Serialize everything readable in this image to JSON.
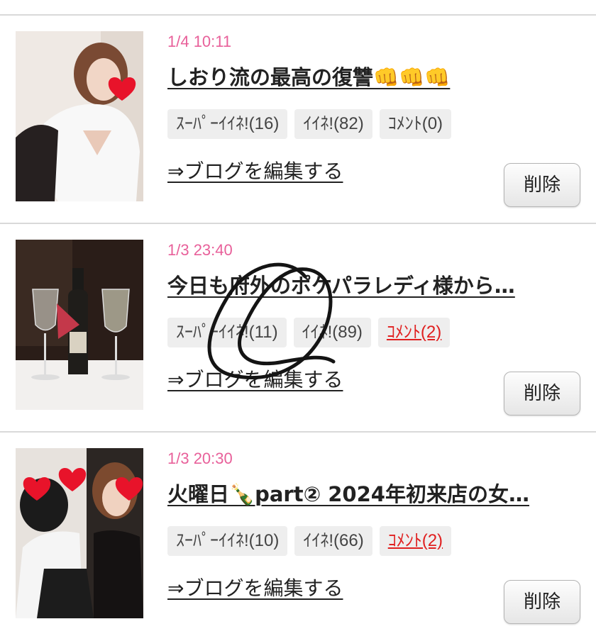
{
  "entries": [
    {
      "date": "1/4 10:11",
      "title": "しおり流の最高の復讐👊👊👊",
      "super_like": "ｽｰﾊﾟｰｲｲﾈ!(16)",
      "like": "ｲｲﾈ!(82)",
      "comment": "ｺﾒﾝﾄ(0)",
      "edit_link": "⇒ブログを編集する",
      "delete_label": "削除"
    },
    {
      "date": "1/3 23:40",
      "title": "今日も府外のポケパラレディ様から…",
      "super_like": "ｽｰﾊﾟｰｲｲﾈ!(11)",
      "like": "ｲｲﾈ!(89)",
      "comment": "ｺﾒﾝﾄ(2)",
      "edit_link": "⇒ブログを編集する",
      "delete_label": "削除"
    },
    {
      "date": "1/3 20:30",
      "title": "火曜日🍾part② 2024年初来店の女…",
      "super_like": "ｽｰﾊﾟｰｲｲﾈ!(10)",
      "like": "ｲｲﾈ!(66)",
      "comment": "ｺﾒﾝﾄ(2)",
      "edit_link": "⇒ブログを編集する",
      "delete_label": "削除"
    }
  ],
  "colors": {
    "date": "#e8609a",
    "comment_link": "#e02020",
    "tag_bg": "#eeeeee",
    "divider": "#d9d9d9"
  }
}
